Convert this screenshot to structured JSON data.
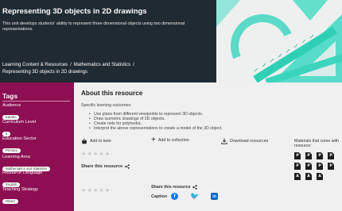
{
  "hero": {
    "title": "Representing 3D objects in 2D drawings",
    "description": "This unit develops students' ability to represent three dimensional objects using two dimensional representations.",
    "breadcrumbs": [
      "Learning Content & Resources",
      "Mathematics and Statistics",
      "Representing 3D objects in 2D drawings"
    ]
  },
  "sidebar": {
    "title": "Tags",
    "groups": [
      {
        "label": "Audience",
        "value": "Kaiako"
      },
      {
        "label": "Curriculum Level",
        "value": "5"
      },
      {
        "label": "Education Sector",
        "value": "Primary"
      },
      {
        "label": "Learning Area",
        "value": "Mathematics and Statistics"
      },
      {
        "label": "Resource Language",
        "value": "English"
      },
      {
        "label": "Teaching Strategy",
        "value": "Mixed"
      }
    ]
  },
  "main": {
    "title": "About this resource",
    "outcomes_label": "Specific learning outcomes:",
    "outcomes": [
      "Use plans from different viewpoints to represent 3D objects.",
      "Draw isometric drawings of 3D objects.",
      "Create nets for polyhedra.",
      "Interpret the above representations to create a model of the 3D object."
    ],
    "actions": {
      "add_to_kete": "Add to kete",
      "add_to_collection": "Add to collection",
      "download": "Download resources"
    },
    "share_label": "Share this resource",
    "share_label_2": "Share this resource",
    "caption_label": "Caption",
    "materials_label_1": "Materials that come with",
    "materials_label_2": "resource:",
    "file_icons": [
      "pdf",
      "pdf",
      "pdf",
      "pdf",
      "pdf",
      "pdf",
      "pdf",
      "pdf",
      "pdf",
      "pdf",
      "pdf"
    ]
  },
  "colors": {
    "hero_bg": "#202a33",
    "sidebar_bg": "#8c0f52",
    "main_bg": "#f0f0f0",
    "image_accent": "#3fd6bf"
  }
}
